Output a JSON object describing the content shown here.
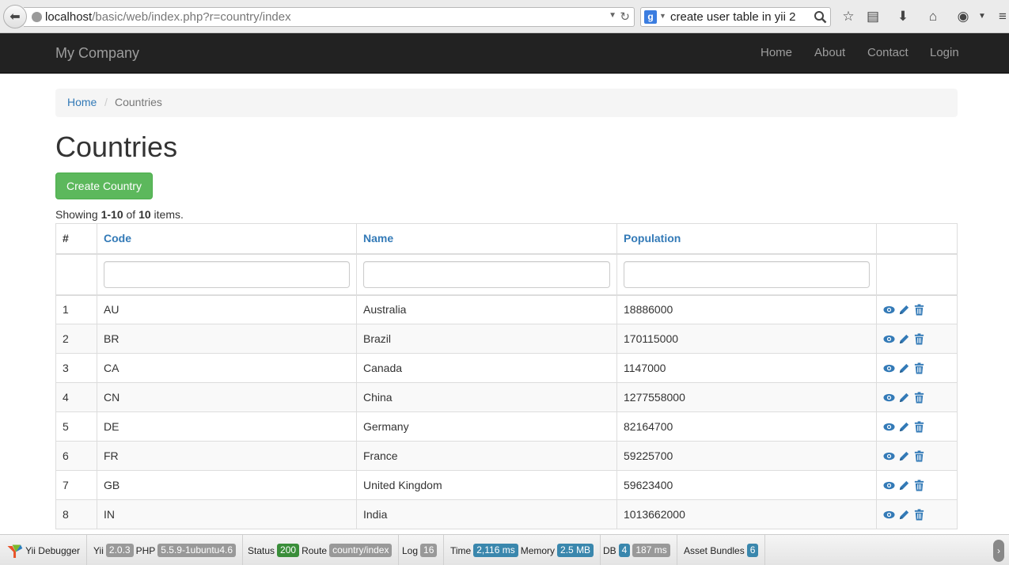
{
  "browser": {
    "url_host": "localhost",
    "url_path": "/basic/web/index.php?r=country/index",
    "search_query": "create user table in yii 2"
  },
  "navbar": {
    "brand": "My Company",
    "items": [
      {
        "label": "Home"
      },
      {
        "label": "About"
      },
      {
        "label": "Contact"
      },
      {
        "label": "Login"
      }
    ]
  },
  "breadcrumb": {
    "home": "Home",
    "separator": "/",
    "current": "Countries"
  },
  "page": {
    "title": "Countries",
    "create_button": "Create Country",
    "summary_prefix": "Showing ",
    "summary_range": "1-10",
    "summary_mid": " of ",
    "summary_total": "10",
    "summary_suffix": " items."
  },
  "table": {
    "headers": [
      "#",
      "Code",
      "Name",
      "Population"
    ],
    "rows": [
      {
        "num": "1",
        "code": "AU",
        "name": "Australia",
        "population": "18886000"
      },
      {
        "num": "2",
        "code": "BR",
        "name": "Brazil",
        "population": "170115000"
      },
      {
        "num": "3",
        "code": "CA",
        "name": "Canada",
        "population": "1147000"
      },
      {
        "num": "4",
        "code": "CN",
        "name": "China",
        "population": "1277558000"
      },
      {
        "num": "5",
        "code": "DE",
        "name": "Germany",
        "population": "82164700"
      },
      {
        "num": "6",
        "code": "FR",
        "name": "France",
        "population": "59225700"
      },
      {
        "num": "7",
        "code": "GB",
        "name": "United Kingdom",
        "population": "59623400"
      },
      {
        "num": "8",
        "code": "IN",
        "name": "India",
        "population": "1013662000"
      }
    ]
  },
  "debugger": {
    "label": "Yii Debugger",
    "yii_label": "Yii",
    "yii_version": "2.0.3",
    "php_label": "PHP",
    "php_version": "5.5.9-1ubuntu4.6",
    "status_label": "Status",
    "status_value": "200",
    "route_label": "Route",
    "route_value": "country/index",
    "log_label": "Log",
    "log_value": "16",
    "time_label": "Time",
    "time_value": "2,116 ms",
    "memory_label": "Memory",
    "memory_value": "2.5 MB",
    "db_label": "DB",
    "db_count": "4",
    "db_time": "187 ms",
    "assets_label": "Asset Bundles",
    "assets_value": "6"
  },
  "colors": {
    "link": "#337ab7",
    "success": "#5cb85c",
    "navbar": "#222222"
  }
}
